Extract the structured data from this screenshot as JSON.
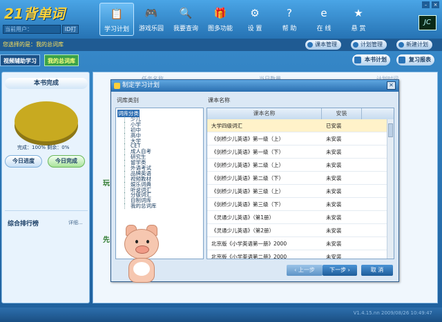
{
  "app": {
    "logo_text": "21背单词",
    "user_placeholder": "当前用户：",
    "user_button": "ID打",
    "logo_box_text": "JC"
  },
  "nav": [
    {
      "label": "学习计划",
      "icon": "clipboard-icon",
      "glyph": "📋",
      "active": true
    },
    {
      "label": "游戏乐园",
      "icon": "gamepad-icon",
      "glyph": "🎮",
      "active": false
    },
    {
      "label": "我要查询",
      "icon": "search-icon",
      "glyph": "🔍",
      "active": false
    },
    {
      "label": "图多功能",
      "icon": "box-icon",
      "glyph": "🎁",
      "active": false
    },
    {
      "label": "设 置",
      "icon": "gear-icon",
      "glyph": "⚙",
      "active": false
    },
    {
      "label": "帮 助",
      "icon": "help-icon",
      "glyph": "?",
      "active": false
    },
    {
      "label": "在 线",
      "icon": "globe-icon",
      "glyph": "e",
      "active": false
    },
    {
      "label": "悬 赏",
      "icon": "reward-icon",
      "glyph": "★",
      "active": false
    }
  ],
  "subbar": {
    "selection_label": "您选择的是：我的总词库",
    "pills": [
      "课本管理",
      "计划管理",
      "新建计划"
    ]
  },
  "tabs": {
    "tab1": "视频辅助学习",
    "tab2": "我的总词库",
    "right_buttons": [
      "本书计划",
      "复习报表"
    ]
  },
  "left_panel": {
    "title": "本书完成",
    "stat": "完成：100%  剩余：0%",
    "btn_today_progress": "今日进度",
    "btn_today_complete": "今日完成",
    "rank_title": "综合排行榜",
    "more": "详细..."
  },
  "main_bg": {
    "header": [
      "任务名称",
      "当日数量",
      "计划时间"
    ],
    "side_texts": [
      "玩",
      "先"
    ]
  },
  "dialog": {
    "title": "制定学习计划",
    "category_label": "词库类别",
    "book_label": "课本名称",
    "tree_root": "词库分类",
    "tree_items": [
      "少儿",
      "小学",
      "初中",
      "高中",
      "大学",
      "CET",
      "成人自考",
      "研究生",
      "留学类",
      "外语考试",
      "品牌英语",
      "视频教材",
      "娱乐词典",
      "听说词汇",
      "分级词汇",
      "自制词库",
      "我的总词库"
    ],
    "columns": [
      "课本名称",
      "安装"
    ],
    "rows": [
      {
        "name": "大学四级词汇",
        "status": "已安装",
        "selected": true
      },
      {
        "name": "《剑桥少儿英语》第一级（上）",
        "status": "未安装",
        "selected": false
      },
      {
        "name": "《剑桥少儿英语》第一级（下）",
        "status": "未安装",
        "selected": false
      },
      {
        "name": "《剑桥少儿英语》第二级（上）",
        "status": "未安装",
        "selected": false
      },
      {
        "name": "《剑桥少儿英语》第二级（下）",
        "status": "未安装",
        "selected": false
      },
      {
        "name": "《剑桥少儿英语》第三级（上）",
        "status": "未安装",
        "selected": false
      },
      {
        "name": "《剑桥少儿英语》第三级（下）",
        "status": "未安装",
        "selected": false
      },
      {
        "name": "《灵通少儿英语》（第1册）",
        "status": "未安装",
        "selected": false
      },
      {
        "name": "《灵通少儿英语》（第2册）",
        "status": "未安装",
        "selected": false
      },
      {
        "name": "北京版《小学英语第一册》2000",
        "status": "未安装",
        "selected": false
      },
      {
        "name": "北京版《小学英语第二册》2000",
        "status": "未安装",
        "selected": false
      }
    ],
    "btn_prev": "上一步",
    "btn_next": "下一步",
    "btn_cancel": "取 消"
  },
  "status": {
    "version": "V1.4.15.nn 2009/08/26 10:49:47"
  },
  "colors": {
    "accent": "#2a74b8",
    "pie": "#c8aa20",
    "selected_row": "#fff2c9"
  }
}
